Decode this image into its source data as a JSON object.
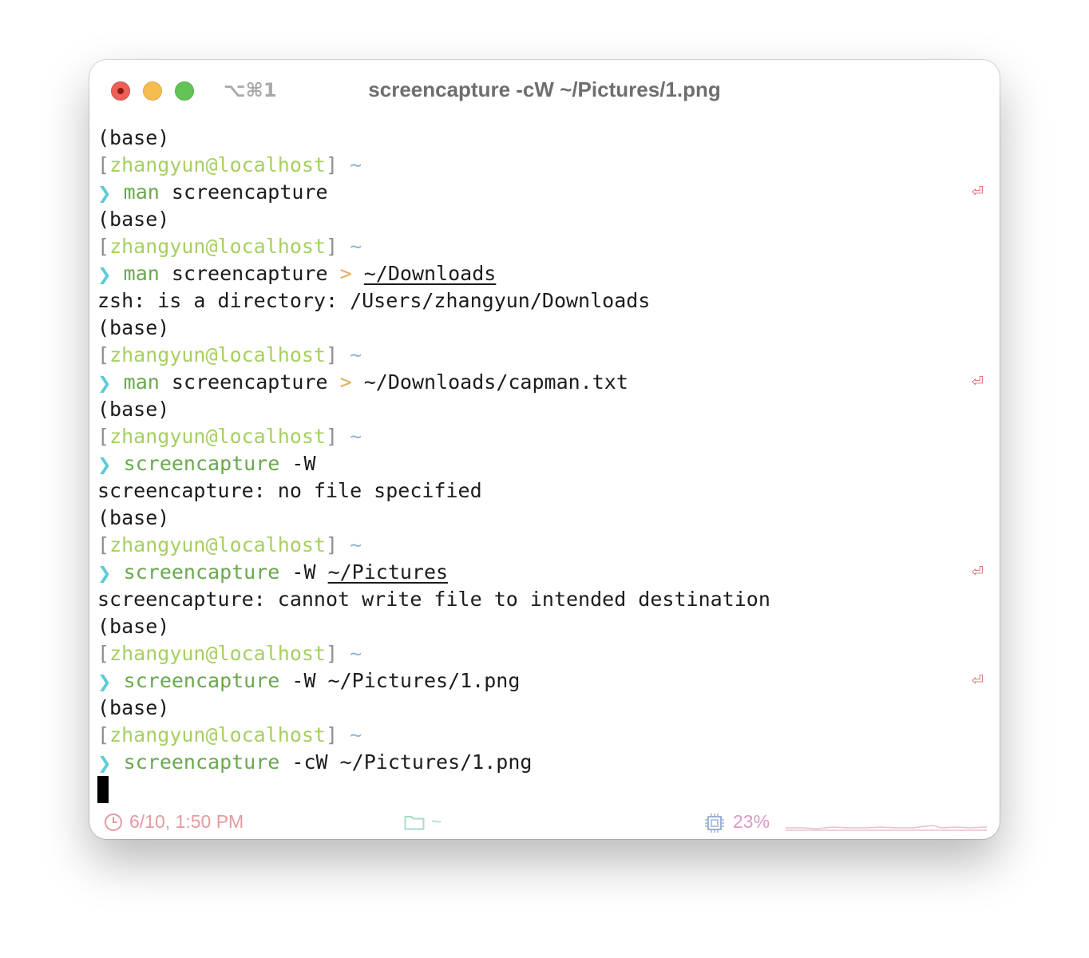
{
  "window": {
    "title": "screencapture -cW ~/Pictures/1.png",
    "shortcut": "⌥⌘1"
  },
  "terminal": {
    "lines": [
      {
        "type": "text",
        "text": "(base)"
      },
      {
        "type": "prompt_header",
        "user": "zhangyun@localhost",
        "dir": "~"
      },
      {
        "type": "command",
        "program": "man",
        "args": "screencapture",
        "redirect": "",
        "target": "",
        "target_underlined": false,
        "return_marker": "⏎"
      },
      {
        "type": "text",
        "text": "(base)"
      },
      {
        "type": "prompt_header",
        "user": "zhangyun@localhost",
        "dir": "~"
      },
      {
        "type": "command",
        "program": "man",
        "args": "screencapture",
        "redirect": ">",
        "target": "~/Downloads",
        "target_underlined": true,
        "return_marker": ""
      },
      {
        "type": "text",
        "text": "zsh: is a directory: /Users/zhangyun/Downloads"
      },
      {
        "type": "text",
        "text": "(base)"
      },
      {
        "type": "prompt_header",
        "user": "zhangyun@localhost",
        "dir": "~"
      },
      {
        "type": "command",
        "program": "man",
        "args": "screencapture",
        "redirect": ">",
        "target": "~/Downloads/capman.txt",
        "target_underlined": false,
        "return_marker": "⏎"
      },
      {
        "type": "text",
        "text": "(base)"
      },
      {
        "type": "prompt_header",
        "user": "zhangyun@localhost",
        "dir": "~"
      },
      {
        "type": "command",
        "program": "screencapture",
        "args": "-W",
        "redirect": "",
        "target": "",
        "target_underlined": false,
        "return_marker": ""
      },
      {
        "type": "text",
        "text": "screencapture: no file specified"
      },
      {
        "type": "text",
        "text": "(base)"
      },
      {
        "type": "prompt_header",
        "user": "zhangyun@localhost",
        "dir": "~"
      },
      {
        "type": "command",
        "program": "screencapture",
        "args": "-W",
        "redirect": "",
        "target": "~/Pictures",
        "target_underlined": true,
        "return_marker": "⏎"
      },
      {
        "type": "text",
        "text": "screencapture: cannot write file to intended destination"
      },
      {
        "type": "text",
        "text": "(base)"
      },
      {
        "type": "prompt_header",
        "user": "zhangyun@localhost",
        "dir": "~"
      },
      {
        "type": "command",
        "program": "screencapture",
        "args": "-W ~/Pictures/1.png",
        "redirect": "",
        "target": "",
        "target_underlined": false,
        "return_marker": "⏎"
      },
      {
        "type": "text",
        "text": "(base)"
      },
      {
        "type": "prompt_header",
        "user": "zhangyun@localhost",
        "dir": "~"
      },
      {
        "type": "command",
        "program": "screencapture",
        "args": "-cW ~/Pictures/1.png",
        "redirect": "",
        "target": "",
        "target_underlined": false,
        "return_marker": ""
      },
      {
        "type": "cursor"
      }
    ]
  },
  "statusbar": {
    "time": "6/10, 1:50 PM",
    "directory": "~",
    "cpu": "23%",
    "icons": [
      "clock-icon",
      "folder-icon",
      "cpu-icon",
      "cpu-sparkline"
    ],
    "colors": {
      "time": "#e49aa0",
      "directory": "#a7dcc4",
      "cpu": "#d99bc4"
    }
  },
  "colors": {
    "user": "#a5d060",
    "tilde": "#8fb4d4",
    "chevron": "#5ccbd6",
    "program": "#6aa84f",
    "redirect": "#e2b05a",
    "return_marker": "#e06c6c"
  }
}
